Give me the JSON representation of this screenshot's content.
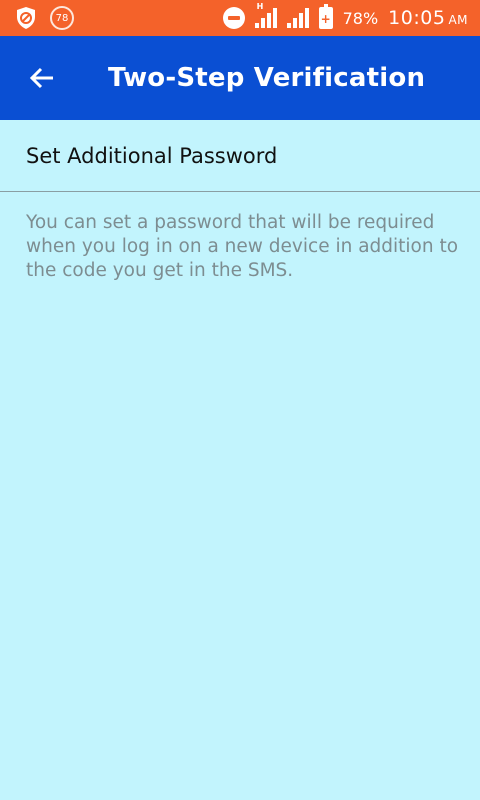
{
  "status_bar": {
    "notification_badge": "78",
    "network_label": "H",
    "battery_percent": "78%",
    "time": "10:05",
    "ampm": "AM",
    "icons": [
      "shield-icon",
      "notification-badge",
      "dnd-icon",
      "signal-h-icon",
      "signal-icon",
      "battery-charging-icon"
    ]
  },
  "app_bar": {
    "title": "Two-Step Verification",
    "back_icon": "arrow-left-icon"
  },
  "settings": {
    "set_password_label": "Set Additional Password",
    "description": "You can set a password that will be required when you log in on a new device in addition to the code you get in the SMS."
  },
  "colors": {
    "status_bar": "#f4622a",
    "app_bar": "#0a4fd3",
    "background": "#c2f4fd",
    "description_text": "#7d8d91"
  }
}
